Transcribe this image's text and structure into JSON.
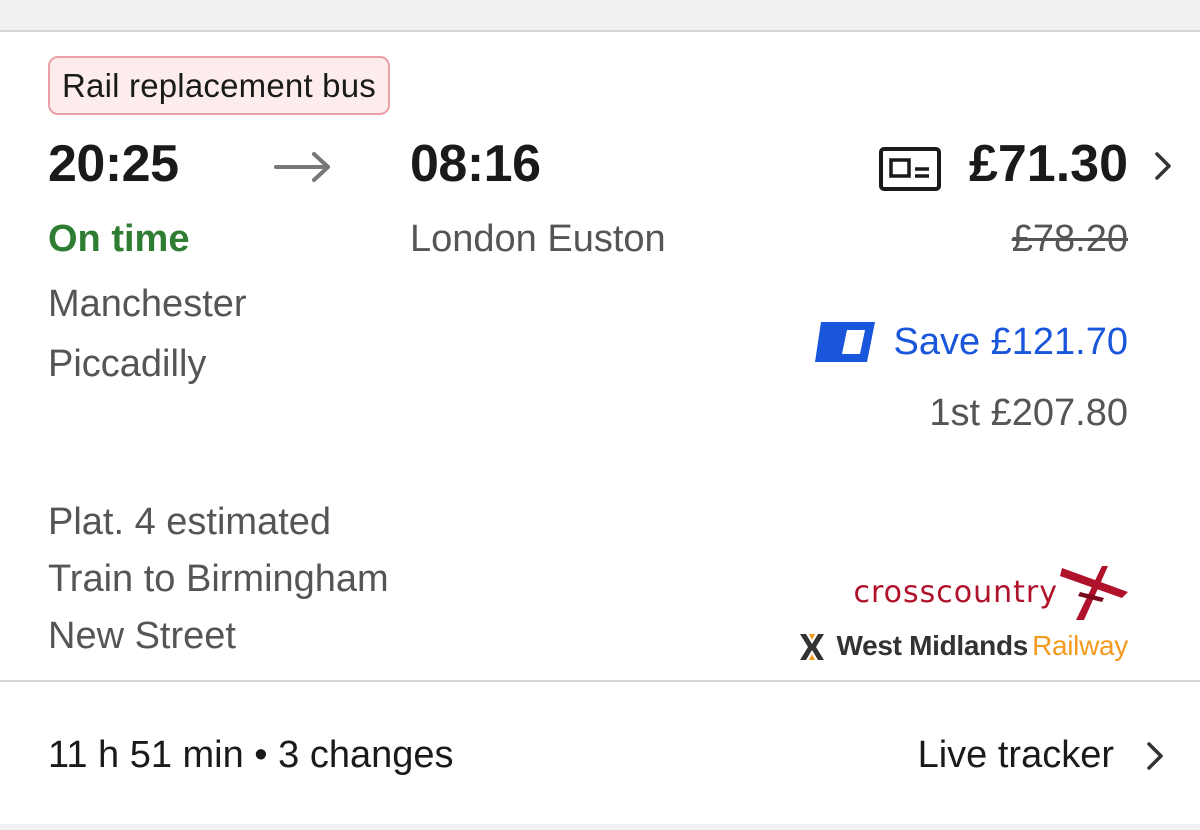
{
  "badge": {
    "label": "Rail replacement bus"
  },
  "journey": {
    "departure_time": "20:25",
    "arrival_time": "08:16",
    "status": "On time",
    "departure_station": "Manchester Piccadilly",
    "arrival_station": "London Euston",
    "platform_lines": [
      "Plat. 4 estimated",
      "Train to Birmingham",
      "New Street"
    ]
  },
  "pricing": {
    "price": "£71.30",
    "original_price": "£78.20",
    "save_label": "Save £121.70",
    "first_class": "1st £207.80"
  },
  "operators": {
    "crosscountry": "crosscountry",
    "wmr_name": "West Midlands",
    "wmr_suffix": "Railway"
  },
  "footer": {
    "summary": "11 h 51 min • 3 changes",
    "live_tracker": "Live tracker"
  },
  "colors": {
    "on_time": "#2e7d32",
    "save": "#1a56db",
    "badge_border": "#e9a0a7",
    "crosscountry": "#b0122c",
    "wmr_orange": "#f39a1f"
  },
  "icons": [
    "arrow-right-icon",
    "ticket-icon",
    "chevron-right-icon",
    "railcard-icon",
    "crosscountry-logo",
    "wmr-logo"
  ]
}
